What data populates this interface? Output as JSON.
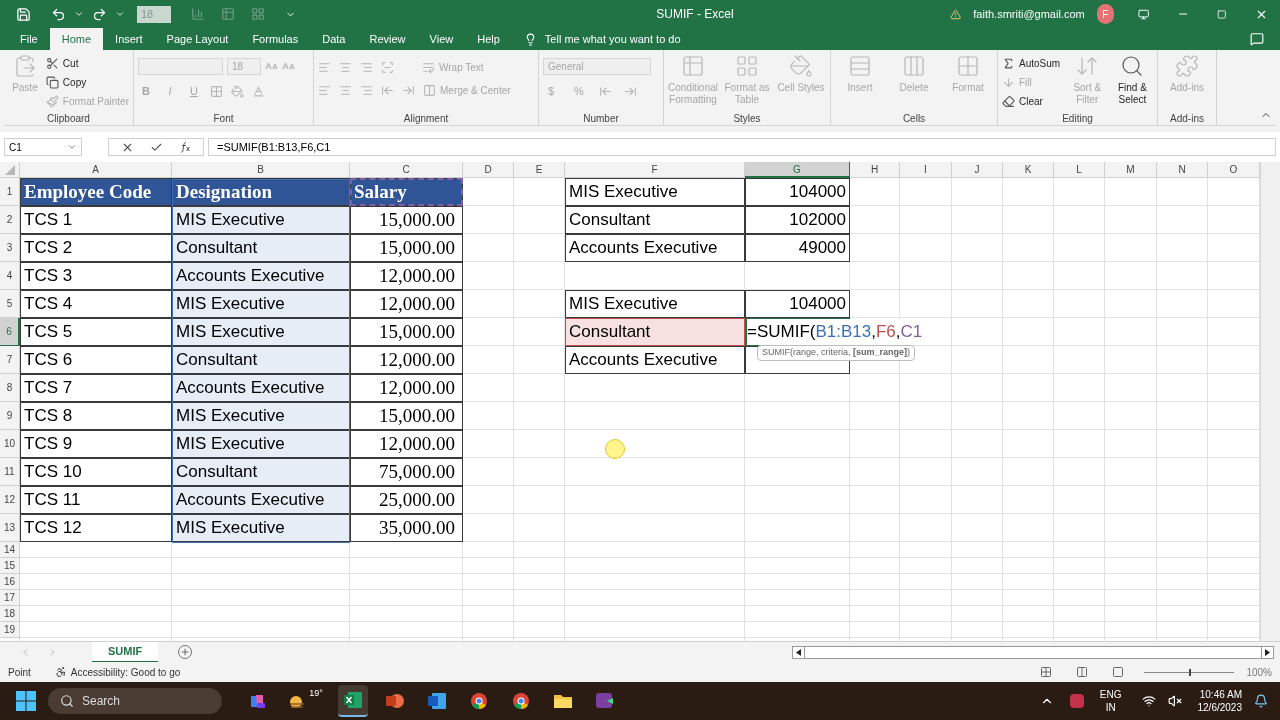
{
  "title_bar": {
    "font_size": "18",
    "title": "SUMIF  -  Excel",
    "account": "faith.smriti@gmail.com",
    "avatar": "F"
  },
  "tabs": [
    {
      "label": "File",
      "selected": false
    },
    {
      "label": "Home",
      "selected": true
    },
    {
      "label": "Insert",
      "selected": false
    },
    {
      "label": "Page Layout",
      "selected": false
    },
    {
      "label": "Formulas",
      "selected": false
    },
    {
      "label": "Data",
      "selected": false
    },
    {
      "label": "Review",
      "selected": false
    },
    {
      "label": "View",
      "selected": false
    },
    {
      "label": "Help",
      "selected": false
    }
  ],
  "tell_me": "Tell me what you want to do",
  "ribbon": [
    {
      "kind": "clipboard",
      "name": "Clipboard",
      "items": [
        {
          "label": "Paste",
          "disabled": true
        },
        {
          "label": "Cut",
          "disabled": false
        },
        {
          "label": "Copy",
          "disabled": false
        },
        {
          "label": "Format Painter",
          "disabled": true
        }
      ]
    },
    {
      "kind": "font",
      "name": "Font",
      "items": [
        {
          "value": "18",
          "disabled": true
        },
        {
          "label": "B",
          "disabled": true
        },
        {
          "label": "I",
          "disabled": true
        },
        {
          "label": "U",
          "disabled": true
        }
      ]
    },
    {
      "kind": "alignment",
      "name": "Alignment",
      "items": [
        {
          "label": "Wrap Text",
          "disabled": true
        },
        {
          "label": "Merge & Center",
          "disabled": true
        }
      ]
    },
    {
      "kind": "number",
      "name": "Number",
      "items": [
        {
          "value": "General",
          "disabled": true
        },
        {
          "label": "$",
          "disabled": true
        },
        {
          "label": "%",
          "disabled": true
        }
      ]
    },
    {
      "kind": "large",
      "name": "Styles",
      "items": [
        {
          "label": "Conditional Formatting",
          "disabled": true
        },
        {
          "label": "Format as Table",
          "disabled": true
        },
        {
          "label": "Cell Styles",
          "disabled": true
        }
      ]
    },
    {
      "kind": "large",
      "name": "Cells",
      "items": [
        {
          "label": "Insert",
          "disabled": true
        },
        {
          "label": "Delete",
          "disabled": true
        },
        {
          "label": "Format",
          "disabled": true
        }
      ]
    },
    {
      "kind": "editing",
      "name": "Editing",
      "items": [
        {
          "label": "AutoSum",
          "disabled": false
        },
        {
          "label": "Fill",
          "disabled": true
        },
        {
          "label": "Clear",
          "disabled": false
        },
        {
          "label": "Sort & Filter",
          "disabled": true
        },
        {
          "label": "Find & Select",
          "disabled": false
        }
      ]
    },
    {
      "kind": "large",
      "name": "Add-ins",
      "items": [
        {
          "label": "Add-ins",
          "disabled": true
        }
      ]
    }
  ],
  "formula_bar": {
    "name_box": "C1",
    "formula": "=SUMIF(B1:B13,F6,C1"
  },
  "columns": [
    {
      "label": "A",
      "selected": false
    },
    {
      "label": "B",
      "selected": false
    },
    {
      "label": "C",
      "selected": false
    },
    {
      "label": "D",
      "selected": false
    },
    {
      "label": "E",
      "selected": false
    },
    {
      "label": "F",
      "selected": false
    },
    {
      "label": "G",
      "selected": true
    },
    {
      "label": "H",
      "selected": false
    },
    {
      "label": "I",
      "selected": false
    },
    {
      "label": "J",
      "selected": false
    },
    {
      "label": "K",
      "selected": false
    },
    {
      "label": "L",
      "selected": false
    },
    {
      "label": "M",
      "selected": false
    },
    {
      "label": "N",
      "selected": false
    },
    {
      "label": "O",
      "selected": false
    }
  ],
  "rows": [
    {
      "label": "1",
      "selected": false
    },
    {
      "label": "2",
      "selected": false
    },
    {
      "label": "3",
      "selected": false
    },
    {
      "label": "4",
      "selected": false
    },
    {
      "label": "5",
      "selected": false
    },
    {
      "label": "6",
      "selected": true
    },
    {
      "label": "7",
      "selected": false
    },
    {
      "label": "8",
      "selected": false
    },
    {
      "label": "9",
      "selected": false
    },
    {
      "label": "10",
      "selected": false
    },
    {
      "label": "11",
      "selected": false
    },
    {
      "label": "12",
      "selected": false
    },
    {
      "label": "13",
      "selected": false
    },
    {
      "label": "14",
      "selected": false
    },
    {
      "label": "15",
      "selected": false
    },
    {
      "label": "16",
      "selected": false
    },
    {
      "label": "17",
      "selected": false
    },
    {
      "label": "18",
      "selected": false
    },
    {
      "label": "19",
      "selected": false
    }
  ],
  "employee_table": {
    "columns": [
      "Employee Code",
      "Designation",
      "Salary"
    ],
    "rows": [
      [
        "TCS 1",
        "MIS Executive",
        "15,000.00"
      ],
      [
        "TCS 2",
        "Consultant",
        "15,000.00"
      ],
      [
        "TCS 3",
        "Accounts Executive",
        "12,000.00"
      ],
      [
        "TCS 4",
        "MIS Executive",
        "12,000.00"
      ],
      [
        "TCS 5",
        "MIS Executive",
        "15,000.00"
      ],
      [
        "TCS 6",
        "Consultant",
        "12,000.00"
      ],
      [
        "TCS 7",
        "Accounts Executive",
        "12,000.00"
      ],
      [
        "TCS 8",
        "MIS Executive",
        "15,000.00"
      ],
      [
        "TCS 9",
        "MIS Executive",
        "12,000.00"
      ],
      [
        "TCS 10",
        "Consultant",
        "75,000.00"
      ],
      [
        "TCS 11",
        "Accounts Executive",
        "25,000.00"
      ],
      [
        "TCS 12",
        "MIS Executive",
        "35,000.00"
      ]
    ]
  },
  "summary_tables": [
    {
      "rows": [
        {
          "label": "MIS Executive",
          "value": "104000"
        },
        {
          "label": "Consultant",
          "value": "102000"
        },
        {
          "label": "Accounts Executive",
          "value": "49000"
        }
      ]
    },
    {
      "rows": [
        {
          "label": "MIS Executive",
          "value": "104000"
        },
        {
          "label": "Consultant",
          "formula": [
            {
              "text": "=SUMIF("
            },
            {
              "text": "B1:B13",
              "color": "#3f6fb6"
            },
            {
              "text": ","
            },
            {
              "text": "F6",
              "color": "#c0504d"
            },
            {
              "text": ","
            },
            {
              "text": "C1",
              "color": "#7f5fa8"
            }
          ]
        },
        {
          "label": "Accounts Executive"
        }
      ]
    }
  ],
  "tooltip": "SUMIF(range, criteria, **[sum_range]**)",
  "sheets": [
    {
      "label": "SUMIF",
      "selected": true
    }
  ],
  "status_bar": {
    "mode": "Point",
    "accessibility": "Accessibility: Good to go",
    "zoom_slider": {
      "level": 0.5
    },
    "zoom": "100%"
  },
  "taskbar": {
    "search": "Search",
    "weather": "19°",
    "apps": [
      {
        "kind": "copilot",
        "selected": false
      },
      {
        "kind": "weather",
        "selected": false
      },
      {
        "kind": "excel",
        "selected": true
      },
      {
        "kind": "powerpoint",
        "selected": false
      },
      {
        "kind": "word",
        "selected": false
      },
      {
        "kind": "chrome",
        "selected": false
      },
      {
        "kind": "chrome",
        "selected": false
      },
      {
        "kind": "explorer",
        "selected": false
      },
      {
        "kind": "clipchamp",
        "selected": false
      }
    ],
    "language": "ENG",
    "region": "IN",
    "time": "10:46 AM",
    "date": "12/6/2023"
  }
}
